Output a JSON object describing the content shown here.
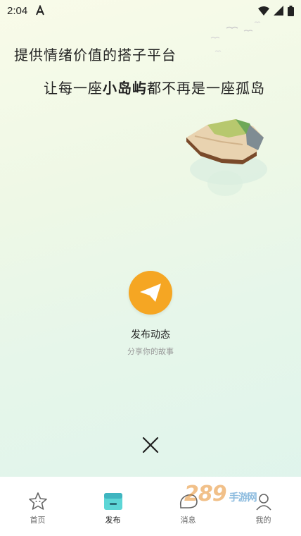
{
  "status": {
    "time": "2:04"
  },
  "headline": {
    "line1": "提供情绪价值的搭子平台",
    "line2_prefix": "让每一座",
    "line2_bold": "小岛屿",
    "line2_suffix": "都不再是一座孤岛"
  },
  "publish": {
    "label": "发布动态",
    "subtitle": "分享你的故事"
  },
  "tabs": [
    {
      "label": "首页",
      "icon": "star-icon"
    },
    {
      "label": "发布",
      "icon": "publish-box-icon"
    },
    {
      "label": "消息",
      "icon": "chat-icon"
    },
    {
      "label": "我的",
      "icon": "profile-icon"
    }
  ],
  "watermark": {
    "text": "289",
    "sub": "手游网"
  },
  "colors": {
    "accent": "#f5a623",
    "tab_active": "#5dd6d6"
  }
}
